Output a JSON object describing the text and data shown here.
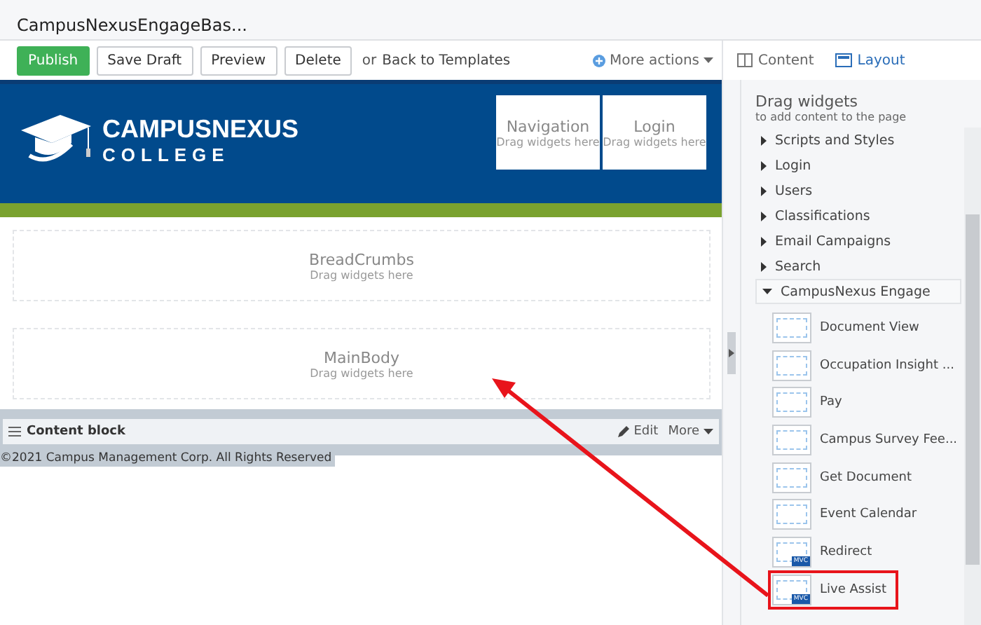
{
  "window": {
    "title": "CampusNexusEngageBas..."
  },
  "toolbar": {
    "buttons": [
      {
        "label": "Publish",
        "kind": "primary"
      },
      {
        "label": "Save Draft",
        "kind": "default"
      },
      {
        "label": "Preview",
        "kind": "default"
      },
      {
        "label": "Delete",
        "kind": "default"
      }
    ],
    "or_text": "or",
    "back_link": "Back to Templates",
    "more_actions": "More actions",
    "view_tabs": [
      {
        "label": "Content",
        "selected": false
      },
      {
        "label": "Layout",
        "selected": true
      }
    ]
  },
  "canvas": {
    "logo": {
      "line1": "CAMPUSNEXUS",
      "line2": "COLLEGE"
    },
    "header_zones": [
      {
        "title": "Navigation",
        "hint": "Drag widgets here"
      },
      {
        "title": "Login",
        "hint": "Drag widgets here"
      }
    ],
    "zones": [
      {
        "title": "BreadCrumbs",
        "hint": "Drag widgets here"
      },
      {
        "title": "MainBody",
        "hint": "Drag widgets here"
      }
    ],
    "content_block": {
      "label": "Content block",
      "edit": "Edit",
      "more": "More"
    },
    "footer": "©2021 Campus Management Corp. All Rights Reserved"
  },
  "panel": {
    "title": "Drag widgets",
    "subtitle": "to add content to the page",
    "categories": [
      {
        "label": "Scripts and Styles",
        "expanded": false
      },
      {
        "label": "Login",
        "expanded": false
      },
      {
        "label": "Users",
        "expanded": false
      },
      {
        "label": "Classifications",
        "expanded": false
      },
      {
        "label": "Email Campaigns",
        "expanded": false
      },
      {
        "label": "Search",
        "expanded": false
      },
      {
        "label": "CampusNexus Engage",
        "expanded": true
      }
    ],
    "widgets": [
      {
        "label": "Document View",
        "kind": "plain",
        "highlighted": false
      },
      {
        "label": "Occupation Insight ...",
        "kind": "plain",
        "highlighted": false
      },
      {
        "label": "Pay",
        "kind": "plain",
        "highlighted": false
      },
      {
        "label": "Campus Survey Fee...",
        "kind": "plain",
        "highlighted": false
      },
      {
        "label": "Get Document",
        "kind": "plain",
        "highlighted": false
      },
      {
        "label": "Event Calendar",
        "kind": "plain",
        "highlighted": false
      },
      {
        "label": "Redirect",
        "kind": "mvc",
        "badge": "MVC",
        "highlighted": false
      },
      {
        "label": "Live Assist",
        "kind": "mvc",
        "badge": "MVC",
        "highlighted": true
      }
    ]
  }
}
